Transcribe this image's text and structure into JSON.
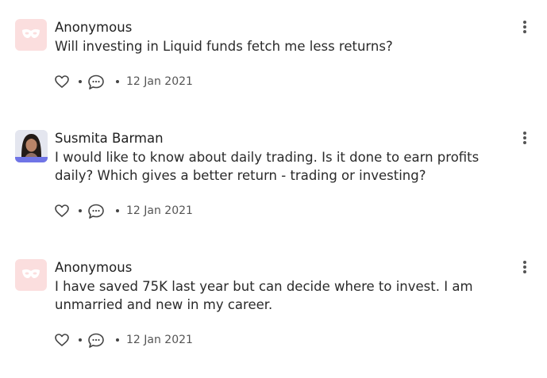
{
  "posts": [
    {
      "author": "Anonymous",
      "avatar": "anonymous-mask-icon",
      "lines": [
        "Will investing in Liquid funds fetch me less returns?"
      ],
      "date": "12 Jan 2021"
    },
    {
      "author": "Susmita Barman",
      "avatar": "user-photo",
      "lines": [
        "I would like to know about daily trading. Is it done to earn profits",
        "daily? Which gives a better return - trading or investing?"
      ],
      "date": "12 Jan 2021"
    },
    {
      "author": "Anonymous",
      "avatar": "anonymous-mask-icon",
      "lines": [
        "I have saved 75K last year but can decide where to invest. I am",
        "unmarried and new in my career."
      ],
      "date": "12 Jan 2021"
    }
  ],
  "icons": {
    "like": "heart-icon",
    "comment": "comment-icon",
    "more": "more-vertical-icon"
  },
  "colors": {
    "anon_avatar_bg": "#fbdede",
    "anon_mask": "#ffffff",
    "text": "#1f1f1f",
    "meta": "#555555"
  }
}
